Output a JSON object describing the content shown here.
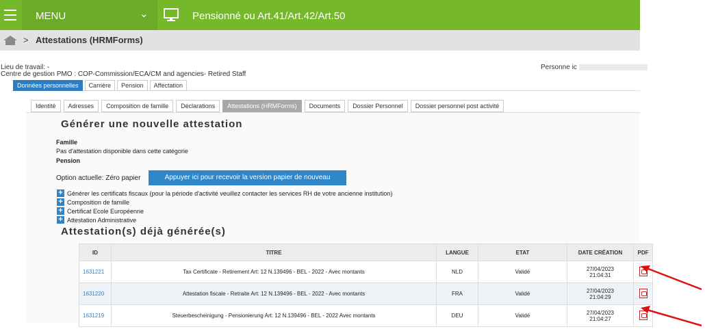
{
  "topbar": {
    "menu_label": "MENU",
    "chevron": "⌄",
    "title": "Pensionné ou Art.41/Art.42/Art.50",
    "icons": {
      "menu": "hamburger-icon",
      "monitor": "monitor-icon"
    }
  },
  "breadcrumb": {
    "separator": ">",
    "current": "Attestations (HRMForms)"
  },
  "info": {
    "line1": "Lieu de travail: -",
    "line2": "Centre de gestion PMO : COP-Commission/ECA/CM and agencies- Retired Staff",
    "person_label": "Personne ic"
  },
  "tabs_main": [
    "Données personnelles",
    "Carrière",
    "Pension",
    "Affectation"
  ],
  "tabs_sub": [
    "Identité",
    "Adresses",
    "Composition de famille",
    "Déclarations",
    "Attestations (HRMForms)",
    "Documents",
    "Dossier Personnel",
    "Dossier personnel post activité"
  ],
  "section1": {
    "heading": "Générer une nouvelle attestation",
    "famille": "Famille",
    "no_attestation": "Pas d'attestation disponible dans cette catégorie",
    "pension": "Pension",
    "option": "Option actuelle: Zéro papier",
    "button": "Appuyer ici pour recevoir la version papier de nouveau",
    "items": [
      "Générer les certificats fiscaux (pour la période d'activité veuillez contacter les services RH de votre ancienne institution)",
      "Composition de famille",
      "Certificat Ecole Européenne",
      "Attestation Administrative"
    ]
  },
  "section2": {
    "heading": "Attestation(s) déjà générée(s)",
    "columns": [
      "ID",
      "TITRE",
      "LANGUE",
      "ETAT",
      "DATE CRÉATION",
      "PDF"
    ],
    "rows": [
      {
        "id": "1631221",
        "titre": "Tax Certificate - Retirement Art: 12 N.139496 - BEL - 2022 - Avec montants",
        "langue": "NLD",
        "etat": "Validé",
        "date": "27/04/2023",
        "time": "21:04:31"
      },
      {
        "id": "1631220",
        "titre": "Attestation fiscale - Retraite Art: 12 N.139496 - BEL - 2022 - Avec montants",
        "langue": "FRA",
        "etat": "Validé",
        "date": "27/04/2023",
        "time": "21:04:29"
      },
      {
        "id": "1631219",
        "titre": "Steuerbescheinigung - Pensionierung Art: 12 N.139496 - BEL - 2022 Avec montants",
        "langue": "DEU",
        "etat": "Validé",
        "date": "27/04/2023",
        "time": "21:04:27"
      }
    ]
  },
  "colors": {
    "topbar": "#75b82a",
    "accent": "#2e86c9",
    "arrow": "#e01010"
  }
}
